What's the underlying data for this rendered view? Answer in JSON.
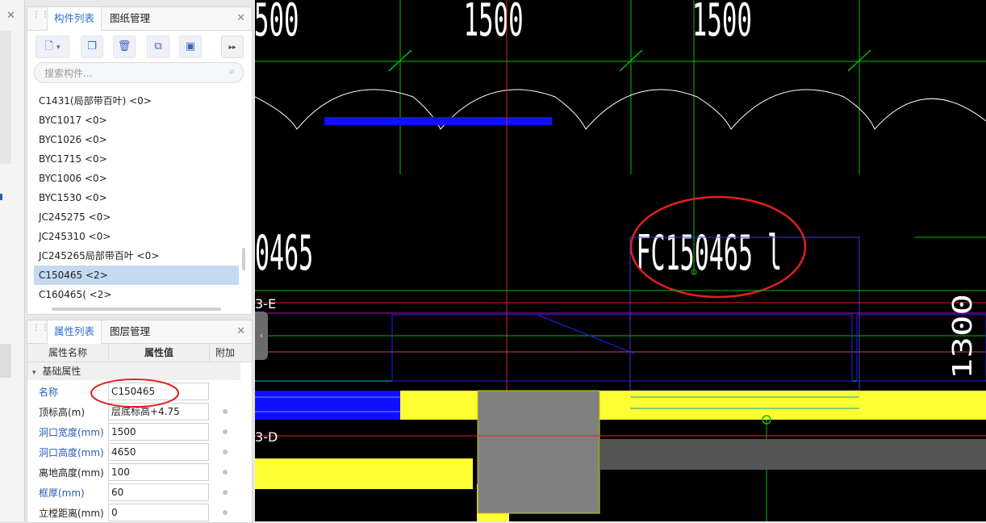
{
  "component_panel": {
    "tabs": [
      "构件列表",
      "图纸管理"
    ],
    "search_placeholder": "搜索构件...",
    "items": [
      "C1431(局部带百叶) <0>",
      "BYC1017 <0>",
      "BYC1026 <0>",
      "BYC1715 <0>",
      "BYC1006 <0>",
      "BYC1530 <0>",
      "JC245275 <0>",
      "JC245310 <0>",
      "JC245265局部带百叶 <0>",
      "C150465 <2>",
      "C160465( <2>"
    ],
    "selected_index": 9
  },
  "property_panel": {
    "tabs": [
      "属性列表",
      "图层管理"
    ],
    "headers": [
      "属性名称",
      "属性值",
      "附加"
    ],
    "group": "基础属性",
    "rows": [
      {
        "label": "名称",
        "value": "C150465"
      },
      {
        "label": "顶标高(m)",
        "value": "层底标高+4.75"
      },
      {
        "label": "洞口宽度(mm)",
        "value": "1500"
      },
      {
        "label": "洞口高度(mm)",
        "value": "4650"
      },
      {
        "label": "离地高度(mm)",
        "value": "100"
      },
      {
        "label": "框厚(mm)",
        "value": "60"
      },
      {
        "label": "立樘距离(mm)",
        "value": "0"
      }
    ]
  },
  "canvas": {
    "dim_top_1": "1500",
    "dim_top_2": "1500",
    "dim_top_left": "500",
    "label_left": "0465",
    "label_main": "FC150465 l",
    "axis_e": "3-E",
    "axis_d": "3-D",
    "dim_right": "1300"
  },
  "colors": {
    "accent": "#2a6fd0",
    "selected": "#c5d9f1",
    "red_mark": "#e02020",
    "yellow": "#ffff33",
    "green": "#00c000",
    "blue_wall": "#1010ff"
  }
}
